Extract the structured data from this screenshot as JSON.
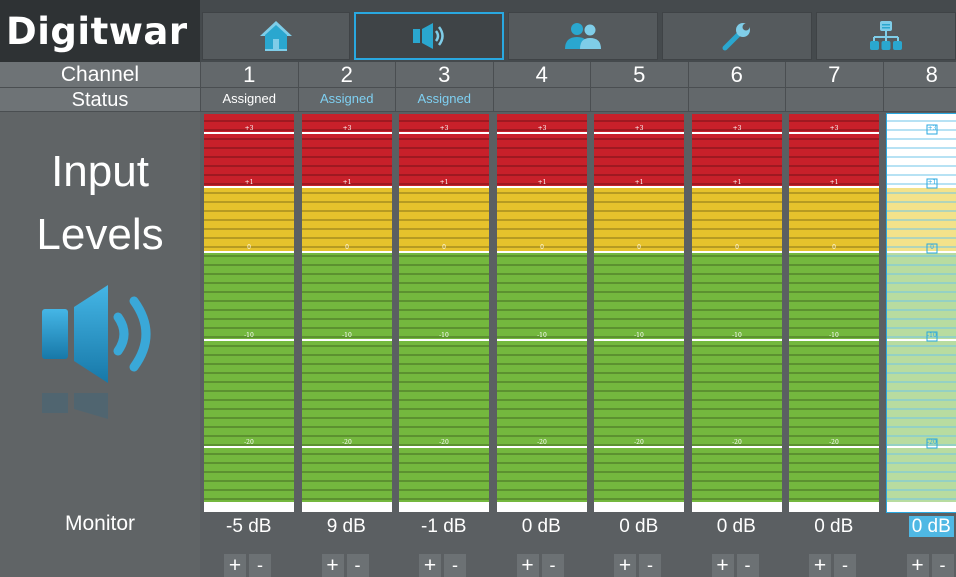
{
  "app": {
    "logo_text": "Digitwar",
    "nav_icons": [
      "home-icon",
      "speaker-icon",
      "users-icon",
      "wrench-icon",
      "network-icon"
    ],
    "active_nav": "speaker-icon"
  },
  "headers": {
    "channel": "Channel",
    "status": "Status"
  },
  "page_title": {
    "line1": "Input",
    "line2": "Levels"
  },
  "monitor_label": "Monitor",
  "meter_labels": [
    "+3",
    "+1",
    "0",
    "-10",
    "-20"
  ],
  "colors": {
    "red": "#c8202a",
    "yellow": "#e6c22c",
    "green": "#74b83e",
    "accent": "#29a8e0",
    "selected": "#4fb8e4"
  },
  "channels": [
    {
      "number": "1",
      "status": "Assigned",
      "status_style": "white",
      "monitor": "-5 dB",
      "selected": false
    },
    {
      "number": "2",
      "status": "Assigned",
      "status_style": "blue",
      "monitor": "9 dB",
      "selected": false
    },
    {
      "number": "3",
      "status": "Assigned",
      "status_style": "blue",
      "monitor": "-1 dB",
      "selected": false
    },
    {
      "number": "4",
      "status": "",
      "status_style": "white",
      "monitor": "0 dB",
      "selected": false
    },
    {
      "number": "5",
      "status": "",
      "status_style": "white",
      "monitor": "0 dB",
      "selected": false
    },
    {
      "number": "6",
      "status": "",
      "status_style": "white",
      "monitor": "0 dB",
      "selected": false
    },
    {
      "number": "7",
      "status": "",
      "status_style": "white",
      "monitor": "0 dB",
      "selected": false
    },
    {
      "number": "8",
      "status": "",
      "status_style": "white",
      "monitor": "0 dB",
      "selected": true
    }
  ],
  "buttons": {
    "plus": "+",
    "minus": "-"
  }
}
